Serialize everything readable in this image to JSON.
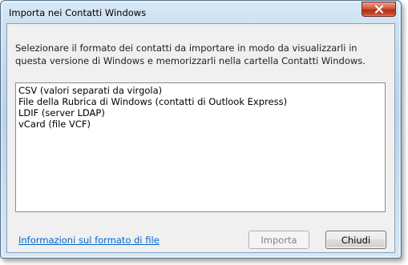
{
  "window": {
    "title": "Importa nei Contatti Windows"
  },
  "instructions": "Selezionare il formato dei contatti da importare in modo da visualizzarli in questa versione di Windows e memorizzarli nella cartella Contatti Windows.",
  "formats": [
    "CSV (valori separati da virgola)",
    "File della Rubrica di Windows (contatti di Outlook Express)",
    "LDIF (server LDAP)",
    "vCard (file VCF)"
  ],
  "footer": {
    "info_link": "Informazioni sul formato di file",
    "import_label": "Importa",
    "close_label": "Chiudi"
  },
  "colors": {
    "link": "#0066cc",
    "close_button": "#c4462b",
    "disabled_text": "#838383"
  },
  "icons": {
    "close": "close-icon"
  }
}
